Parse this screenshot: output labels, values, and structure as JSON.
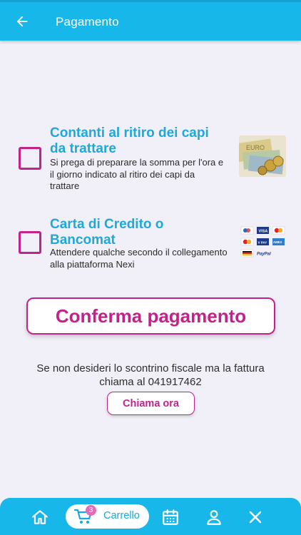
{
  "appbar": {
    "title": "Pagamento",
    "back_icon": "arrow-left-icon"
  },
  "payment_options": [
    {
      "title": "Contanti al ritiro dei capi da trattare",
      "description": "Si prega di preparare la somma per l'ora e il giorno indicato al ritiro dei capi da trattare",
      "icon": "cash-euro-image",
      "checked": false
    },
    {
      "title": "Carta di Credito o Bancomat",
      "description": "Attendere qualche secondo il collegamento alla piattaforma Nexi",
      "icon": "card-logos-image",
      "card_logos": [
        "Maestro",
        "VISA",
        "MasterCard",
        "V PAY",
        "MasterCard",
        "AMEX",
        "PayPal"
      ],
      "checked": false
    }
  ],
  "confirm_label": "Conferma pagamento",
  "invoice_note": {
    "line1": "Se non desideri lo scontrino fiscale ma la fattura",
    "line2": "chiama al 041917462"
  },
  "call_label": "Chiama ora",
  "bottom_nav": {
    "cart_label": "Carrello",
    "cart_count": "3",
    "items": [
      "home-icon",
      "cart-icon",
      "calendar-icon",
      "user-icon",
      "close-icon"
    ]
  },
  "colors": {
    "primary": "#18b7e9",
    "accent": "#c2228a",
    "title_blue": "#1fa8d8",
    "background": "#f1eff7"
  }
}
